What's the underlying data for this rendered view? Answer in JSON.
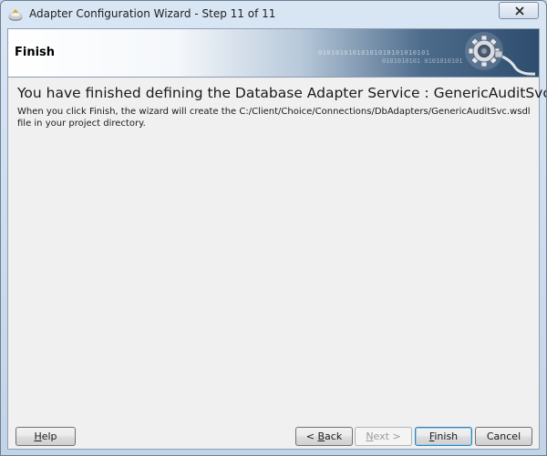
{
  "window": {
    "title": "Adapter Configuration Wizard - Step 11 of 11"
  },
  "banner": {
    "title": "Finish",
    "binary_line1": "01010101010101010101010101",
    "binary_line2": "0101010101 0101010101"
  },
  "content": {
    "heading": "You have finished defining the Database Adapter Service : GenericAuditSvc",
    "description": "When you click Finish, the wizard will create the C:/Client/Choice/Connections/DbAdapters/GenericAuditSvc.wsdl file in your project directory."
  },
  "buttons": {
    "help": {
      "pre": "",
      "mnemonic": "H",
      "post": "elp"
    },
    "back": {
      "pre": "< ",
      "mnemonic": "B",
      "post": "ack"
    },
    "next": {
      "pre": "",
      "mnemonic": "N",
      "post": "ext >"
    },
    "finish": {
      "pre": "",
      "mnemonic": "F",
      "post": "inish"
    },
    "cancel": {
      "pre": "Cancel",
      "mnemonic": "",
      "post": ""
    }
  },
  "icons": {
    "app": "adapter-wizard-icon",
    "close": "close-icon",
    "banner": "gear-icon"
  }
}
